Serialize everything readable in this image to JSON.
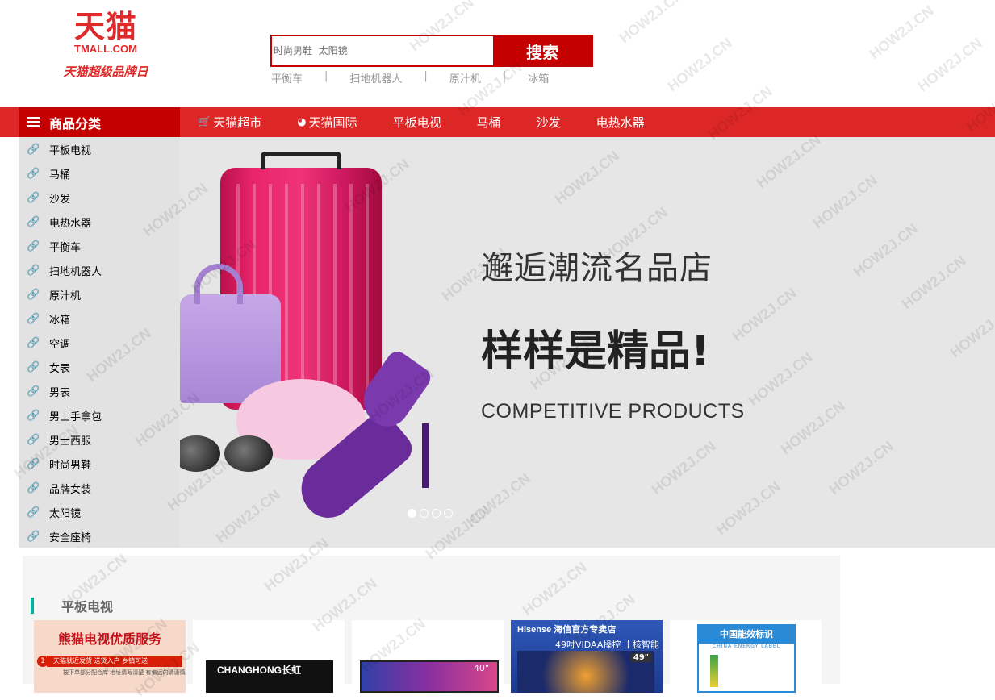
{
  "logo": {
    "main": "天猫",
    "sub": "TMALL.COM",
    "slogan": "天猫超级品牌日"
  },
  "search": {
    "placeholder": "时尚男鞋  太阳镜",
    "button": "搜索"
  },
  "hot_words": [
    "平衡车",
    "扫地机器人",
    "原汁机",
    "冰箱"
  ],
  "category_header": "商品分类",
  "nav_links": [
    {
      "label": "天猫超市",
      "icon": "cart-icon"
    },
    {
      "label": "天猫国际",
      "icon": "globe-icon"
    },
    {
      "label": "平板电视"
    },
    {
      "label": "马桶"
    },
    {
      "label": "沙发"
    },
    {
      "label": "电热水器"
    }
  ],
  "categories": [
    "平板电视",
    "马桶",
    "沙发",
    "电热水器",
    "平衡车",
    "扫地机器人",
    "原汁机",
    "冰箱",
    "空调",
    "女表",
    "男表",
    "男士手拿包",
    "男士西服",
    "时尚男鞋",
    "品牌女装",
    "太阳镜",
    "安全座椅"
  ],
  "banner": {
    "title": "邂逅潮流名品店",
    "subtitle": "样样是精品!",
    "english": "COMPETITIVE PRODUCTS",
    "dots": 4,
    "active_dot": 1
  },
  "section": {
    "title": "平板电视",
    "products": {
      "p1": {
        "title": "熊猫电视优质服务",
        "line1": "天猫就近发货 送货入户 乡镇可送",
        "line2": "按下单部分配仓库 地址请写清楚 有偏远的请谨慎"
      },
      "p2": {
        "brand": "CHANGHONG长虹"
      },
      "p3": {
        "size": "40\""
      },
      "p4": {
        "brand": "Hisense 海信官方专卖店",
        "tagline": "49吋VIDAA操控 十核智能",
        "size": "49\""
      },
      "p5": {
        "label": "中国能效标识",
        "label_en": "CHINA ENERGY LABEL"
      }
    }
  },
  "watermark": "HOW2J.CN",
  "colors": {
    "brand_red": "#dd2727",
    "dark_red": "#c40000",
    "accent_teal": "#00b19e"
  }
}
